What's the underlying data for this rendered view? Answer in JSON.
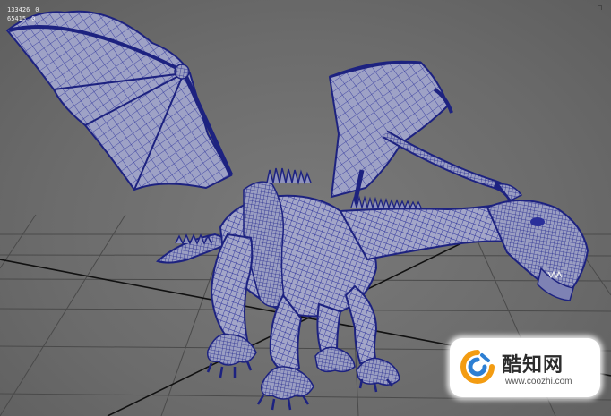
{
  "viewport": {
    "background_color": "#6e6e6e",
    "grid_color": "#4a4a4a",
    "axis_color": "#111111"
  },
  "hud": {
    "rows": [
      {
        "value_a": "133426",
        "value_b": "0"
      },
      {
        "value_a": "65415",
        "value_b": "0"
      }
    ]
  },
  "model": {
    "subject": "dragon-wireframe",
    "wire_color": "#2a2f9a",
    "surface_color": "#9fa3c4"
  },
  "watermark": {
    "brand": "酷知网",
    "url": "www.coozhi.com",
    "logo_colors": [
      "#f39c12",
      "#2d7fd3"
    ]
  }
}
